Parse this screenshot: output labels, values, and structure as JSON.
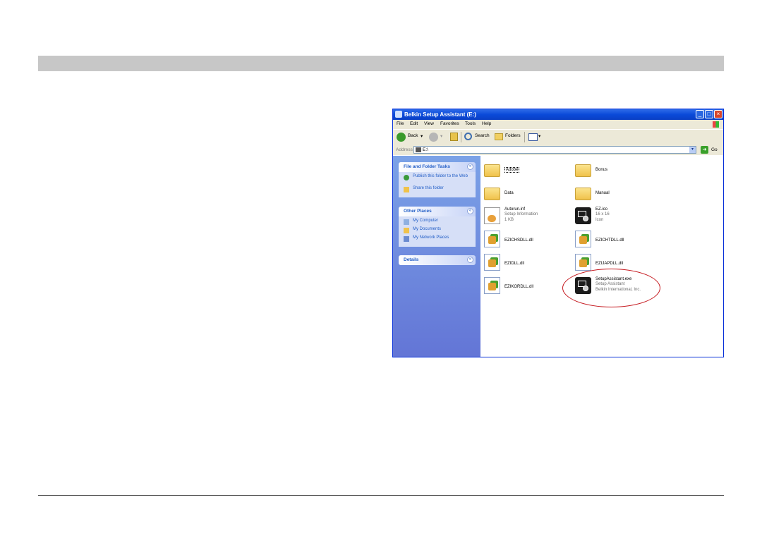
{
  "window": {
    "title": "Belkin Setup Assistant (E:)",
    "buttons": {
      "minimize": "_",
      "maximize": "□",
      "close": "×"
    }
  },
  "menu": [
    "File",
    "Edit",
    "View",
    "Favorites",
    "Tools",
    "Help"
  ],
  "toolbar": {
    "back": "Back",
    "search": "Search",
    "folders": "Folders"
  },
  "address": {
    "label": "Address",
    "value": "E:\\",
    "go": "Go"
  },
  "taskpane": {
    "file_tasks": {
      "title": "File and Folder Tasks",
      "links": [
        "Publish this folder to the Web",
        "Share this folder"
      ]
    },
    "other_places": {
      "title": "Other Places",
      "links": [
        "My Computer",
        "My Documents",
        "My Network Places"
      ]
    },
    "details": {
      "title": "Details"
    }
  },
  "files": [
    {
      "name": "Adobe",
      "kind": "folder"
    },
    {
      "name": "Bonus",
      "kind": "folder"
    },
    {
      "name": "Data",
      "kind": "folder"
    },
    {
      "name": "Manual",
      "kind": "folder"
    },
    {
      "name": "Autorun.inf",
      "kind": "inf",
      "meta1": "Setup Information",
      "meta2": "1 KB"
    },
    {
      "name": "EZ.ico",
      "kind": "exe",
      "meta1": "16 x 16",
      "meta2": "Icon"
    },
    {
      "name": "EZICHSDLL.dll",
      "kind": "dll"
    },
    {
      "name": "EZICHTDLL.dll",
      "kind": "dll"
    },
    {
      "name": "EZIDLL.dll",
      "kind": "dll"
    },
    {
      "name": "EZIJAPDLL.dll",
      "kind": "dll"
    },
    {
      "name": "EZIKORDLL.dll",
      "kind": "dll"
    },
    {
      "name": "SetupAssistant.exe",
      "kind": "exe",
      "meta1": "Setup Assistant",
      "meta2": "Belkin International, Inc."
    }
  ],
  "colors": {
    "xp_title_blue": "#0a4ad9",
    "highlight_red": "#c4161c",
    "header_band": "#c7c7c7"
  }
}
